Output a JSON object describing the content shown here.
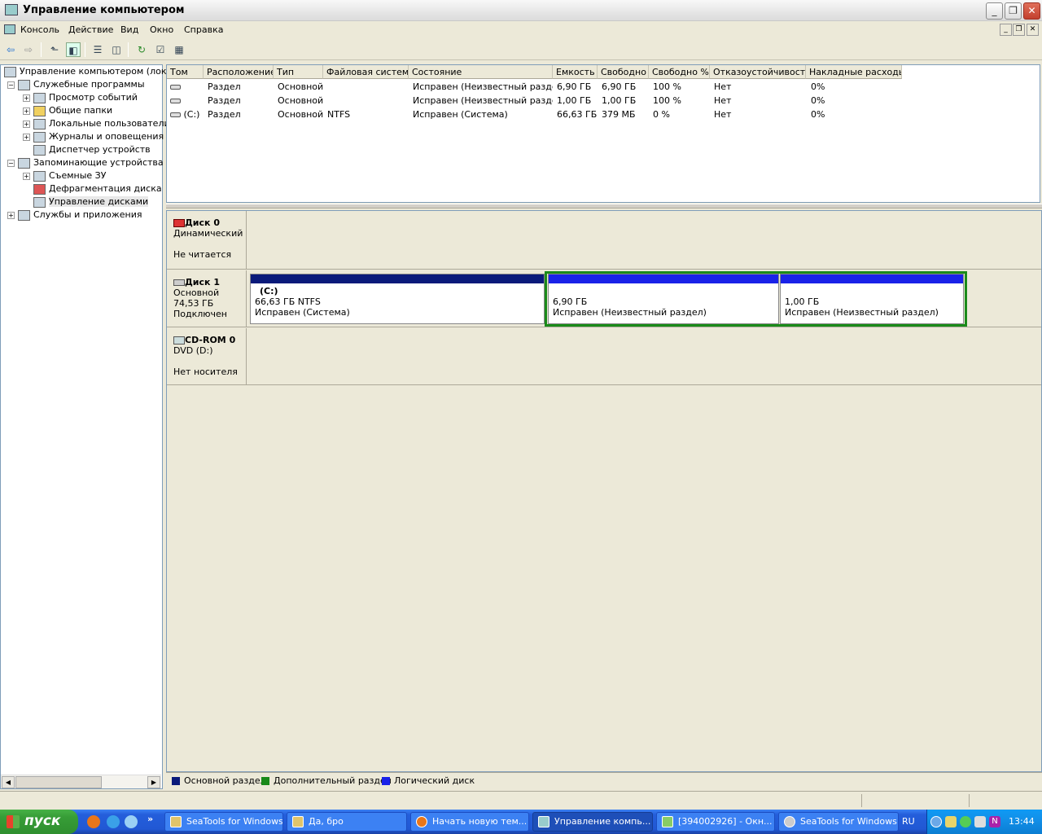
{
  "window": {
    "title": "Управление компьютером"
  },
  "menu": [
    "Консоль",
    "Действие",
    "Вид",
    "Окно",
    "Справка"
  ],
  "tree": {
    "root": "Управление компьютером (локаль",
    "items": [
      "Служебные программы",
      "Просмотр событий",
      "Общие папки",
      "Локальные пользователи",
      "Журналы и оповещения пр",
      "Диспетчер устройств",
      "Запоминающие устройства",
      "Съемные ЗУ",
      "Дефрагментация диска",
      "Управление дисками",
      "Службы и приложения"
    ]
  },
  "volumes": {
    "columns": [
      "Том",
      "Расположение",
      "Тип",
      "Файловая система",
      "Состояние",
      "Емкость",
      "Свободно",
      "Свободно %",
      "Отказоустойчивость",
      "Накладные расходы"
    ],
    "rows": [
      [
        "",
        "Раздел",
        "Основной",
        "",
        "Исправен (Неизвестный раздел)",
        "6,90 ГБ",
        "6,90 ГБ",
        "100 %",
        "Нет",
        "0%"
      ],
      [
        "",
        "Раздел",
        "Основной",
        "",
        "Исправен (Неизвестный раздел)",
        "1,00 ГБ",
        "1,00 ГБ",
        "100 %",
        "Нет",
        "0%"
      ],
      [
        "(C:)",
        "Раздел",
        "Основной",
        "NTFS",
        "Исправен (Система)",
        "66,63 ГБ",
        "379 МБ",
        "0 %",
        "Нет",
        "0%"
      ]
    ]
  },
  "disks": [
    {
      "name": "Диск 0",
      "type": "Динамический",
      "size": "",
      "state": "Не читается"
    },
    {
      "name": "Диск 1",
      "type": "Основной",
      "size": "74,53 ГБ",
      "state": "Подключен"
    },
    {
      "name": "CD-ROM 0",
      "type": "DVD (D:)",
      "size": "",
      "state": "Нет носителя"
    }
  ],
  "partitions": [
    {
      "label": "(C:)",
      "size": "66,63 ГБ NTFS",
      "status": "Исправен (Система)"
    },
    {
      "label": "",
      "size": "6,90 ГБ",
      "status": "Исправен (Неизвестный раздел)"
    },
    {
      "label": "",
      "size": "1,00 ГБ",
      "status": "Исправен (Неизвестный раздел)"
    }
  ],
  "legend": [
    "Основной раздел",
    "Дополнительный раздел",
    "Логический диск"
  ],
  "colors": {
    "primary": "#0a1a7a",
    "extended": "#1a8a1a",
    "logical": "#1a22e8"
  },
  "taskbar": {
    "start": "пуск",
    "tasks": [
      "SeaTools for Windows",
      "Да, бро",
      "Начать новую тем...",
      "Управление компь...",
      "[394002926] - Окн...",
      "SeaTools for Windows"
    ],
    "lang": "RU",
    "clock": "13:44"
  }
}
